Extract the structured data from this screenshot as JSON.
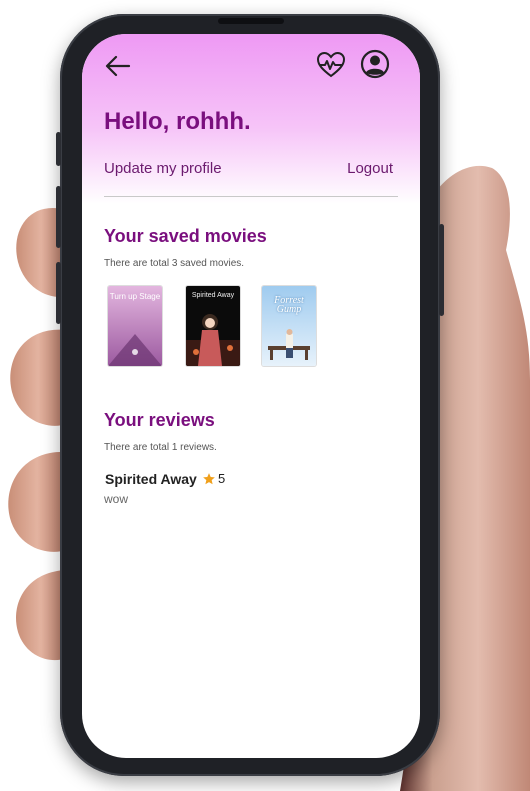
{
  "header": {
    "greeting": "Hello, rohhh.",
    "update_profile_label": "Update my profile",
    "logout_label": "Logout"
  },
  "saved_movies": {
    "heading": "Your saved movies",
    "count_text": "There are total 3 saved movies.",
    "posters": [
      {
        "title": "Turn up Stage",
        "colors": [
          "#d6a4d6",
          "#8e4a91"
        ]
      },
      {
        "title": "Spirited Away",
        "colors": [
          "#0b0b0b",
          "#a0302c"
        ]
      },
      {
        "title": "Forrest Gump",
        "colors": [
          "#9ec9ee",
          "#e8f2fb"
        ]
      }
    ]
  },
  "reviews": {
    "heading": "Your reviews",
    "count_text": "There are total 1 reviews.",
    "items": [
      {
        "movie": "Spirited Away",
        "rating": "5",
        "comment": "wow"
      }
    ]
  },
  "icons": {
    "back": "arrow-left-icon",
    "health": "heart-pulse-icon",
    "account": "user-circle-icon",
    "rating": "star-icon"
  },
  "colors": {
    "accent": "#7a0f7e",
    "header_gradient_top": "#ee99f4",
    "star": "#f0a01c"
  }
}
